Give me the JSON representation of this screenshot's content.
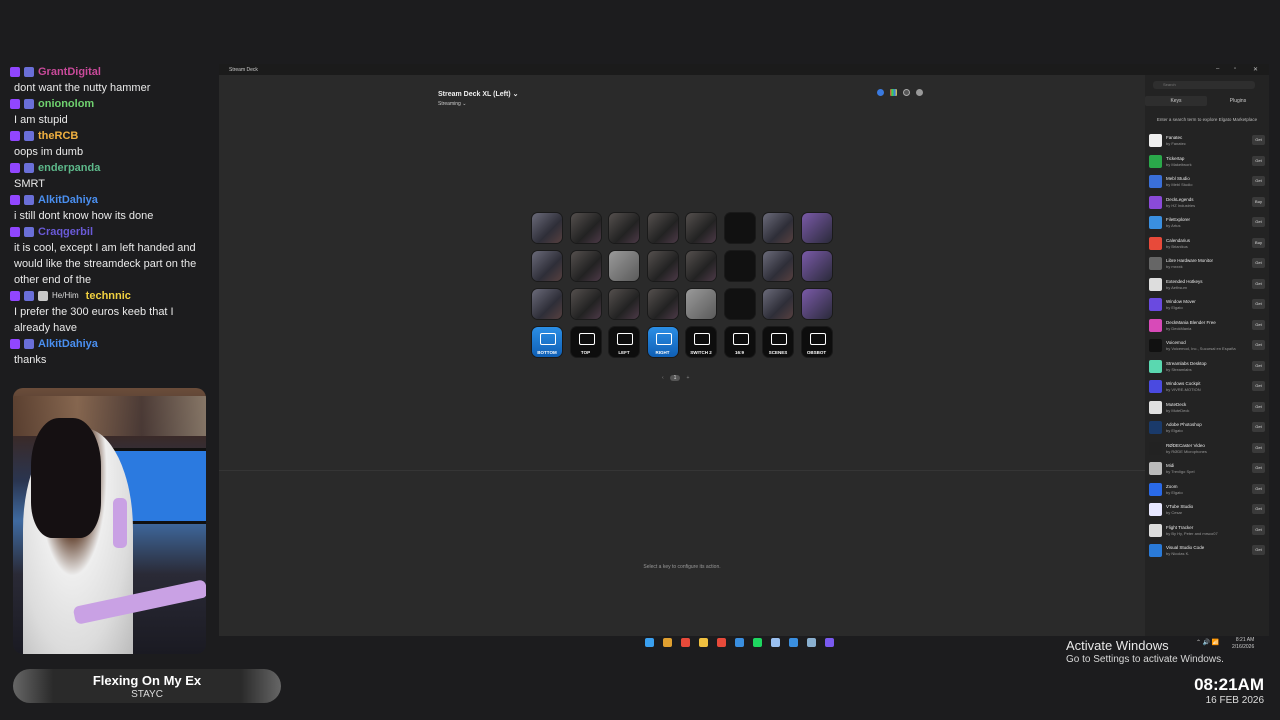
{
  "chat": [
    {
      "user": "GrantDigital",
      "color": "#c84a9a",
      "badges": [
        "twitch-icon",
        "sub-icon"
      ],
      "pronoun": "",
      "text": "dont want the nutty hammer"
    },
    {
      "user": "onionolom",
      "color": "#6fd26f",
      "badges": [
        "twitch-icon",
        "pixel-icon"
      ],
      "pronoun": "",
      "text": "I am stupid"
    },
    {
      "user": "theRCB",
      "color": "#f0b040",
      "badges": [
        "twitch-icon",
        "speaker-icon"
      ],
      "pronoun": "",
      "text": "oops im dumb"
    },
    {
      "user": "enderpanda",
      "color": "#5db88a",
      "badges": [
        "twitch-icon",
        "pencil-icon"
      ],
      "pronoun": "",
      "text": "SMRT"
    },
    {
      "user": "AlkitDahiya",
      "color": "#4a8ff0",
      "badges": [
        "twitch-icon",
        "controller-icon"
      ],
      "pronoun": "",
      "text": "i still dont know how its done"
    },
    {
      "user": "Craqgerbil",
      "color": "#6a5ad8",
      "badges": [
        "twitch-icon",
        "robot-icon"
      ],
      "pronoun": "",
      "text": "it is cool, except I am left handed and would like the streamdeck part on the other end of the"
    },
    {
      "user": "technnic",
      "color": "#f0d040",
      "badges": [
        "twitch-icon",
        "shield-icon",
        "gift-icon"
      ],
      "pronoun": "He/Him",
      "text": "I prefer the 300 euros keeb that I already have"
    },
    {
      "user": "AlkitDahiya",
      "color": "#4a8ff0",
      "badges": [
        "twitch-icon",
        "controller-icon"
      ],
      "pronoun": "",
      "text": "thanks"
    }
  ],
  "now_playing": {
    "title": "Flexing On My Ex",
    "artist": "STAYC"
  },
  "window": {
    "title": "Stream Deck",
    "min": "–",
    "max": "▫",
    "close": "✕"
  },
  "device": {
    "name": "Stream Deck XL (Left)",
    "profile": "Streaming"
  },
  "keys": [
    {
      "style": "photo2",
      "label": ""
    },
    {
      "style": "photo",
      "label": ""
    },
    {
      "style": "photo",
      "label": ""
    },
    {
      "style": "photo",
      "label": ""
    },
    {
      "style": "photo",
      "label": ""
    },
    {
      "style": "dark",
      "label": ""
    },
    {
      "style": "photo2",
      "label": ""
    },
    {
      "style": "purple",
      "label": ""
    },
    {
      "style": "photo2",
      "label": ""
    },
    {
      "style": "photo",
      "label": ""
    },
    {
      "style": "light",
      "label": ""
    },
    {
      "style": "photo",
      "label": ""
    },
    {
      "style": "photo",
      "label": ""
    },
    {
      "style": "dark",
      "label": ""
    },
    {
      "style": "photo2",
      "label": ""
    },
    {
      "style": "purple",
      "label": ""
    },
    {
      "style": "photo2",
      "label": ""
    },
    {
      "style": "photo",
      "label": ""
    },
    {
      "style": "photo",
      "label": ""
    },
    {
      "style": "photo",
      "label": ""
    },
    {
      "style": "light",
      "label": ""
    },
    {
      "style": "dark",
      "label": ""
    },
    {
      "style": "photo2",
      "label": ""
    },
    {
      "style": "purple",
      "label": ""
    },
    {
      "style": "blue",
      "label": "BOTTOM"
    },
    {
      "style": "black",
      "label": "TOP"
    },
    {
      "style": "black",
      "label": "LEFT"
    },
    {
      "style": "blue",
      "label": "RIGHT"
    },
    {
      "style": "black",
      "label": "SWITCH 2"
    },
    {
      "style": "black",
      "label": "16:9"
    },
    {
      "style": "black",
      "label": "SCENES"
    },
    {
      "style": "black",
      "label": "OBSBOT"
    }
  ],
  "page_indicator": {
    "current": "1"
  },
  "hint": "Select a key to configure its action.",
  "panel": {
    "search_placeholder": "Search",
    "tabs": [
      "Keys",
      "Plugins"
    ],
    "market_hint": "Enter a search term to explore Elgato Marketplace",
    "plugins": [
      {
        "name": "Fanatec",
        "by": "by Fanatec",
        "btn": "Get",
        "color": "#eeeeee"
      },
      {
        "name": "Tickertap",
        "by": "by Makeitwork",
        "btn": "Get",
        "color": "#2aa84a"
      },
      {
        "name": "Mebl Studio",
        "by": "by Mebl Studio",
        "btn": "Get",
        "color": "#3a6fd8"
      },
      {
        "name": "DeckLegends",
        "by": "by HZ Industries",
        "btn": "Buy",
        "color": "#8a4ad8"
      },
      {
        "name": "FileExplorer",
        "by": "by Artus",
        "btn": "Get",
        "color": "#3a8fe0"
      },
      {
        "name": "Calendarius",
        "by": "by Brianikus",
        "btn": "Buy",
        "color": "#e84a3a"
      },
      {
        "name": "Libre Hardware Monitor",
        "by": "by mxxxk",
        "btn": "Get",
        "color": "#666666"
      },
      {
        "name": "Extended Hotkeys",
        "by": "by Aethsum",
        "btn": "Get",
        "color": "#dddddd"
      },
      {
        "name": "Window Mover",
        "by": "by Elgato",
        "btn": "Get",
        "color": "#6a4ae0"
      },
      {
        "name": "DeckMania Blender Free",
        "by": "by DeckMania",
        "btn": "Get",
        "color": "#d84ab8"
      },
      {
        "name": "Voicemod",
        "by": "by Voicemod, Inc., Sucursal en España",
        "btn": "Get",
        "color": "#111111"
      },
      {
        "name": "Streamlabs Desktop",
        "by": "by Streamlabs",
        "btn": "Get",
        "color": "#5ad8b0"
      },
      {
        "name": "Windows Cockpit",
        "by": "by VIVRE-MOTION",
        "btn": "Get",
        "color": "#4a4ae0"
      },
      {
        "name": "MuteDeck",
        "by": "by MuteDeck",
        "btn": "Get",
        "color": "#e0e0e0"
      },
      {
        "name": "Adobe Photoshop",
        "by": "by Elgato",
        "btn": "Get",
        "color": "#1a3a6a"
      },
      {
        "name": "RØDECaster Video",
        "by": "by RØDE Microphones",
        "btn": "Get",
        "color": "#222222"
      },
      {
        "name": "Midi",
        "by": "by Trevligo Spel",
        "btn": "Get",
        "color": "#bbbbbb"
      },
      {
        "name": "Zoom",
        "by": "by Elgato",
        "btn": "Get",
        "color": "#2a6ae8"
      },
      {
        "name": "VTube Studio",
        "by": "by Cesar",
        "btn": "Get",
        "color": "#e8e8ff"
      },
      {
        "name": "Flight Tracker",
        "by": "by By Hy, Peter and mrsco07",
        "btn": "Get",
        "color": "#dddddd"
      },
      {
        "name": "Visual Studio Code",
        "by": "by Nicolas K.",
        "btn": "Get",
        "color": "#2a7ad8"
      }
    ]
  },
  "taskbar": [
    "start-icon",
    "browser-icon",
    "chrome-icon",
    "folder-icon",
    "app-icon",
    "stream-deck-icon",
    "spotify-icon",
    "app2-icon",
    "app3-icon",
    "app4-icon",
    "grid-icon"
  ],
  "tray": {
    "time": "8:21 AM",
    "date": "2/16/2026"
  },
  "activate": {
    "title": "Activate Windows",
    "sub": "Go to Settings to activate Windows."
  },
  "overlay_clock": {
    "time": "08:21AM",
    "date": "16 FEB 2026"
  }
}
